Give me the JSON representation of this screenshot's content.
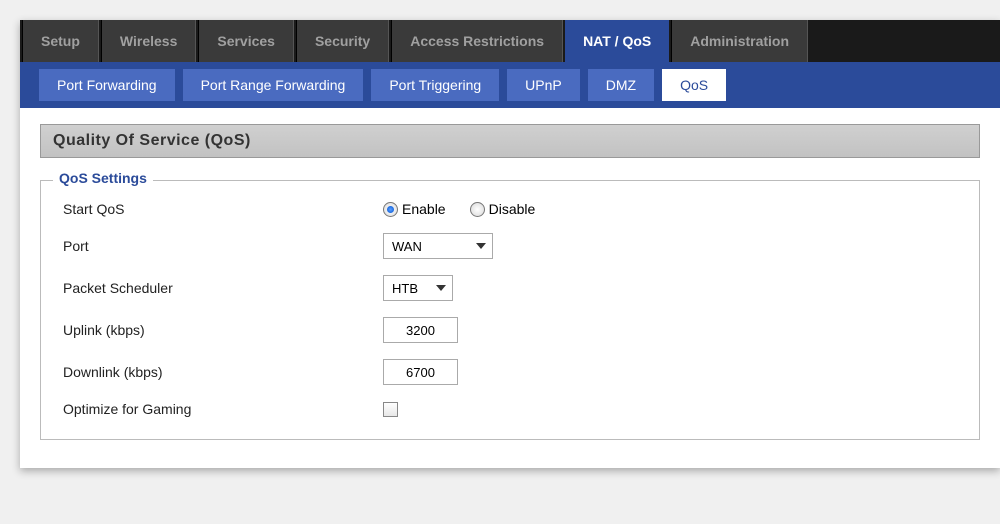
{
  "topTabs": [
    {
      "label": "Setup",
      "active": false
    },
    {
      "label": "Wireless",
      "active": false
    },
    {
      "label": "Services",
      "active": false
    },
    {
      "label": "Security",
      "active": false
    },
    {
      "label": "Access Restrictions",
      "active": false
    },
    {
      "label": "NAT / QoS",
      "active": true
    },
    {
      "label": "Administration",
      "active": false
    }
  ],
  "subTabs": [
    {
      "label": "Port Forwarding",
      "active": false
    },
    {
      "label": "Port Range Forwarding",
      "active": false
    },
    {
      "label": "Port Triggering",
      "active": false
    },
    {
      "label": "UPnP",
      "active": false
    },
    {
      "label": "DMZ",
      "active": false
    },
    {
      "label": "QoS",
      "active": true
    }
  ],
  "section": {
    "title": "Quality Of Service (QoS)",
    "legend": "QoS Settings"
  },
  "form": {
    "startQos": {
      "label": "Start QoS",
      "enable": "Enable",
      "disable": "Disable",
      "value": "enable"
    },
    "port": {
      "label": "Port",
      "value": "WAN"
    },
    "scheduler": {
      "label": "Packet Scheduler",
      "value": "HTB"
    },
    "uplink": {
      "label": "Uplink (kbps)",
      "value": "3200"
    },
    "downlink": {
      "label": "Downlink (kbps)",
      "value": "6700"
    },
    "gaming": {
      "label": "Optimize for Gaming",
      "checked": false
    }
  }
}
